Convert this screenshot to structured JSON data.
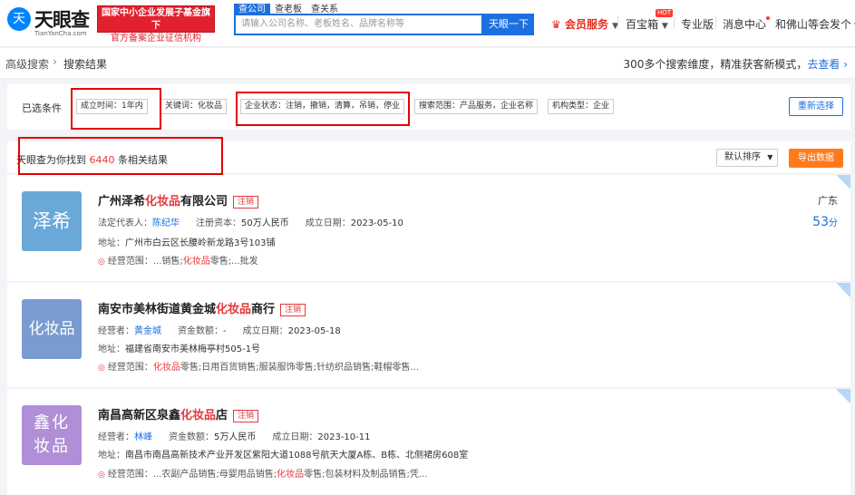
{
  "header": {
    "logo_icon": "天",
    "logo_title": "天眼查",
    "logo_sub": "TianYanCha.com",
    "promo_line1": "国家中小企业发展子基金旗下",
    "promo_line2": "官方备案企业征信机构",
    "search_tabs": [
      "查公司",
      "查老板",
      "查关系"
    ],
    "search_placeholder": "请输入公司名称、老板姓名、品牌名称等",
    "search_button": "天眼一下",
    "nav_vip": "会员服务",
    "nav_baibao": "百宝箱",
    "nav_baibao_badge": "HOT",
    "nav_pro": "专业版",
    "nav_msg": "消息中心",
    "nav_user": "和佛山等会发个"
  },
  "breadcrumb": {
    "root": "高级搜索",
    "current": "搜索结果",
    "right_text": "300多个搜索维度，精准获客新模式，",
    "right_link": "去查看"
  },
  "filters": {
    "label": "已选条件",
    "chips": [
      "成立时间：1年内",
      "关键词：化妆品",
      "企业状态：注销，撤销，清算，吊销，停业",
      "搜索范围：产品服务，企业名称",
      "机构类型：企业"
    ],
    "reset_button": "重新选择"
  },
  "results": {
    "prefix": "天眼查为你找到",
    "count": "6440",
    "suffix": "条相关结果",
    "sort_button": "默认排序",
    "export_button": "导出数据"
  },
  "companies": [
    {
      "avatar_text": "泽希",
      "avatar_color": "#6aa8d8",
      "name_pre": "广州泽希",
      "name_hl": "化妆品",
      "name_post": "有限公司",
      "tag": "注销",
      "rep_label": "法定代表人：",
      "rep": "陈纪华",
      "cap_label": "注册资本：",
      "cap": "50万人民币",
      "date_label": "成立日期：",
      "date": "2023-05-10",
      "addr_label": "地址：",
      "addr": "广州市白云区长腰岭新龙路3号103铺",
      "scope_label": "经营范围：",
      "scope_pre": "...销售;",
      "scope_hl": "化妆品",
      "scope_post": "零售;...批发",
      "province": "广东",
      "score": "53",
      "score_unit": "分"
    },
    {
      "avatar_text": "化妆品",
      "avatar_color": "#7a9bd0",
      "name_pre": "南安市美林街道黄金城",
      "name_hl": "化妆品",
      "name_post": "商行",
      "tag": "注销",
      "rep_label": "经营者：",
      "rep": "黄金城",
      "cap_label": "资金数额：",
      "cap": "-",
      "date_label": "成立日期：",
      "date": "2023-05-18",
      "addr_label": "地址：",
      "addr": "福建省南安市美林梅亭村505-1号",
      "scope_label": "经营范围：",
      "scope_pre": "",
      "scope_hl": "化妆品",
      "scope_post": "零售;日用百货销售;服装服饰零售;针纺织品销售;鞋帽零售...",
      "province": "",
      "score": "",
      "score_unit": ""
    },
    {
      "avatar_text": "鑫化妆品",
      "avatar_color": "#b08fd6",
      "name_pre": "南昌高新区泉鑫",
      "name_hl": "化妆品",
      "name_post": "店",
      "tag": "注销",
      "rep_label": "经营者：",
      "rep": "林峰",
      "cap_label": "资金数额：",
      "cap": "5万人民币",
      "date_label": "成立日期：",
      "date": "2023-10-11",
      "addr_label": "地址：",
      "addr": "南昌市南昌高新技术产业开发区紫阳大道1088号航天大厦A栋、B栋、北侧裙房608室",
      "scope_label": "经营范围：",
      "scope_pre": "...农副产品销售;母婴用品销售;",
      "scope_hl": "化妆品",
      "scope_post": "零售;包装材料及制品销售;凭...",
      "province": "",
      "score": "",
      "score_unit": ""
    }
  ]
}
